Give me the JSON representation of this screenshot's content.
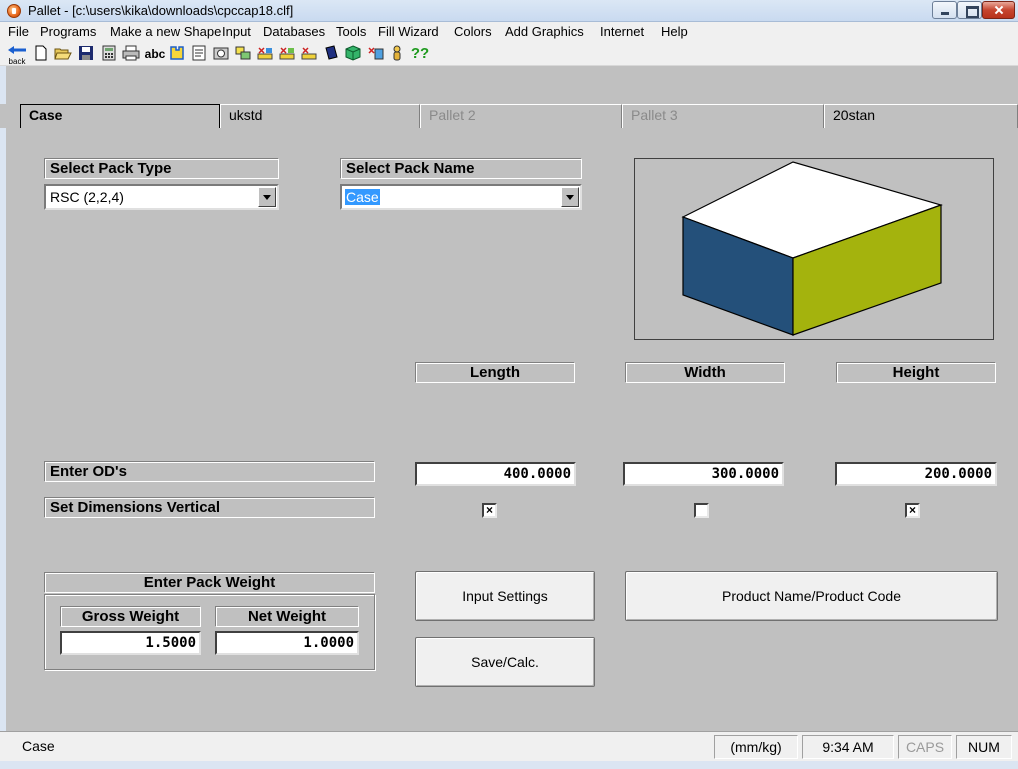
{
  "window": {
    "title": "Pallet - [c:\\users\\kika\\downloads\\cpccap18.clf]"
  },
  "menu": [
    "File",
    "Programs",
    "Make a new Shape",
    "Input",
    "Databases",
    "Tools",
    "Fill Wizard",
    "Colors",
    "Add Graphics",
    "Internet",
    "Help"
  ],
  "toolbar": {
    "back_label": "back",
    "spell_label": "abc",
    "help_label": "??"
  },
  "tabs": [
    {
      "label": "Case",
      "state": "active"
    },
    {
      "label": "ukstd",
      "state": "normal"
    },
    {
      "label": "Pallet 2",
      "state": "disabled"
    },
    {
      "label": "Pallet 3",
      "state": "disabled"
    },
    {
      "label": "20stan",
      "state": "normal"
    }
  ],
  "pack_type": {
    "header": "Select Pack Type",
    "value": "RSC (2,2,4)"
  },
  "pack_name": {
    "header": "Select Pack Name",
    "value": "Case"
  },
  "box_colors": {
    "top": "#ffffff",
    "left": "#24507a",
    "right": "#a4b30d"
  },
  "dimensions": {
    "headers": [
      "Length",
      "Width",
      "Height"
    ],
    "od_label": "Enter OD's",
    "od_values": [
      "400.0000",
      "300.0000",
      "200.0000"
    ],
    "vertical_label": "Set Dimensions Vertical",
    "vertical_checks": [
      true,
      false,
      true
    ]
  },
  "weight": {
    "header": "Enter Pack Weight",
    "gross_label": "Gross Weight",
    "gross_value": "1.5000",
    "net_label": "Net Weight",
    "net_value": "1.0000"
  },
  "buttons": {
    "input_settings": "Input Settings",
    "product_name": "Product Name/Product Code",
    "save_calc": "Save/Calc."
  },
  "status": {
    "message": "Case",
    "units": "(mm/kg)",
    "time": "9:34 AM",
    "caps": "CAPS",
    "num": "NUM"
  }
}
